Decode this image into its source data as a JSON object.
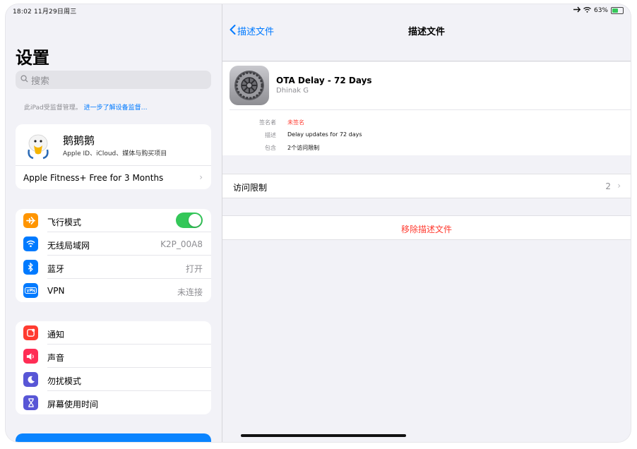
{
  "status_bar": {
    "time_date": "18:02  11月29日周三",
    "battery": "63%",
    "battery_fraction": 0.63
  },
  "sidebar": {
    "title": "设置",
    "search_placeholder": "搜索",
    "supervised_text": "此iPad受监督管理。",
    "supervised_link": "进一步了解设备监督…",
    "profile": {
      "name": "鹅鹅鹅",
      "subtitle": "Apple ID、iCloud、媒体与购买项目"
    },
    "promo": "Apple Fitness+ Free for 3 Months",
    "group1": [
      {
        "label": "飞行模式",
        "value": "",
        "icon": "airplane-icon",
        "color": "#ff9500",
        "toggle_on": true
      },
      {
        "label": "无线局域网",
        "value": "K2P_00A8",
        "icon": "wifi-icon",
        "color": "#007aff"
      },
      {
        "label": "蓝牙",
        "value": "打开",
        "icon": "bluetooth-icon",
        "color": "#007aff"
      },
      {
        "label": "VPN",
        "value": "未连接",
        "icon": "vpn-icon",
        "color": "#007aff"
      }
    ],
    "group2": [
      {
        "label": "通知",
        "icon": "notification-icon",
        "color": "#ff3b30"
      },
      {
        "label": "声音",
        "icon": "speaker-icon",
        "color": "#ff2d55"
      },
      {
        "label": "勿扰模式",
        "icon": "moon-icon",
        "color": "#5856d6"
      },
      {
        "label": "屏幕使用时间",
        "icon": "hourglass-icon",
        "color": "#5856d6"
      }
    ]
  },
  "detail": {
    "back_label": "描述文件",
    "title": "描述文件",
    "profile_name": "OTA Delay - 72 Days",
    "profile_author": "Dhinak G",
    "rows": [
      {
        "key": "签名者",
        "value": "未签名",
        "color": "#ff3b30"
      },
      {
        "key": "描述",
        "value": "Delay updates for 72 days",
        "color": "#111111"
      },
      {
        "key": "包含",
        "value": "2个访问限制",
        "color": "#111111"
      }
    ],
    "restrictions_label": "访问限制",
    "restrictions_count": "2",
    "remove_label": "移除描述文件"
  }
}
